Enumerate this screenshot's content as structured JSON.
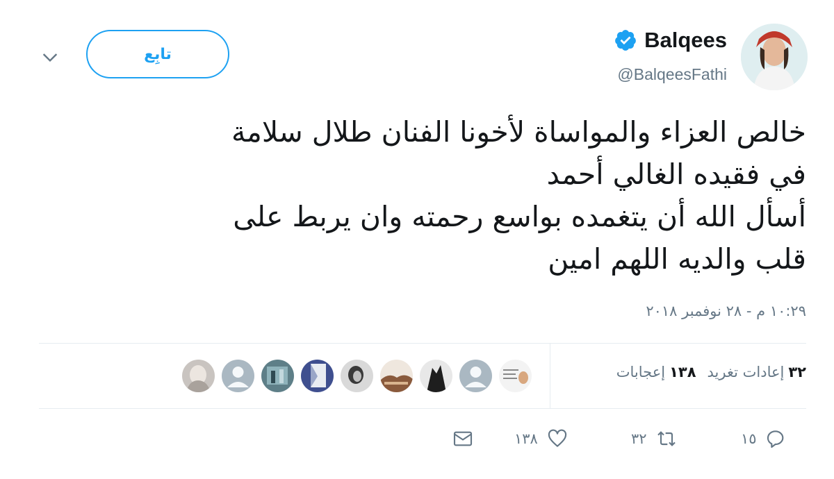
{
  "header": {
    "display_name": "Balqees",
    "handle": "@BalqeesFathi",
    "follow_label": "تابِع"
  },
  "tweet": {
    "lines": [
      "خالص العزاء والمواساة لأخونا الفنان طلال سلامة",
      "في فقيده الغالي أحمد",
      "أسأل الله أن يتغمده بواسع رحمته وان يربط على",
      "قلب والديه اللهم امين"
    ],
    "timestamp": "١٠:٢٩ م - ٢٨ نوفمبر ٢٠١٨"
  },
  "stats": {
    "retweets_count": "٣٢",
    "retweets_label": "إعادات تغريد",
    "likes_count": "١٣٨",
    "likes_label": "إعجابات"
  },
  "actions": {
    "reply_count": "١٥",
    "retweet_count": "٣٢",
    "like_count": "١٣٨"
  },
  "colors": {
    "accent": "#1da1f2",
    "secondary_text": "#657786",
    "divider": "#e6ecf0"
  }
}
